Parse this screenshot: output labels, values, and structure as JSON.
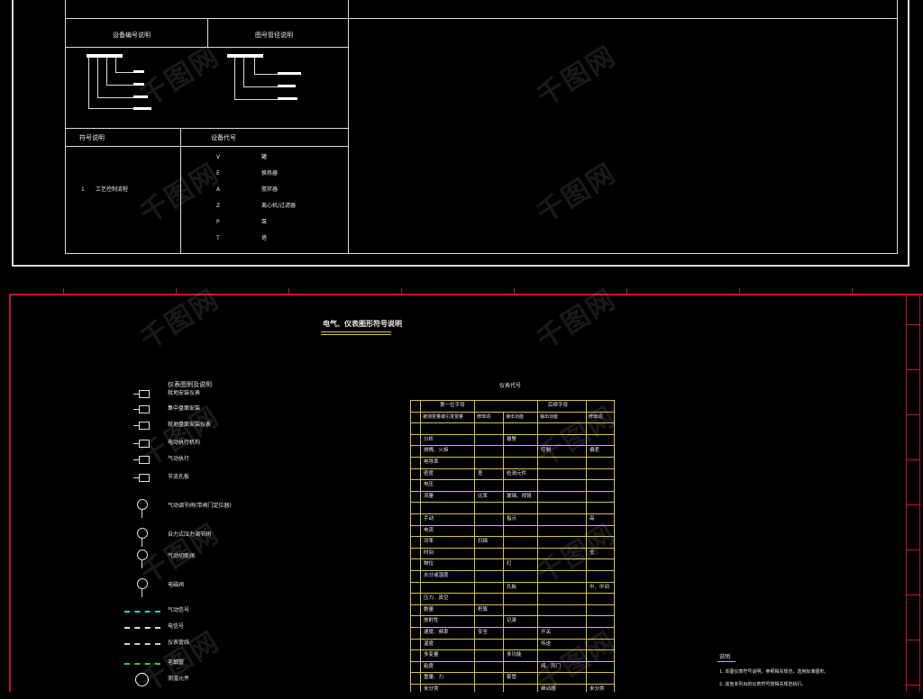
{
  "upper": {
    "legend_number_header": "设备编号说明",
    "legend_pipe_header": "图号管径说明",
    "process_header": "符号说明",
    "device_header": "设备代号",
    "process_item_no": "1",
    "process_item_text": "工艺控制流程",
    "device_codes": [
      {
        "code": "V",
        "name": "罐"
      },
      {
        "code": "E",
        "name": "换热器"
      },
      {
        "code": "A",
        "name": "搅拌器"
      },
      {
        "code": "Z",
        "name": "离心机/过滤器"
      },
      {
        "code": "P",
        "name": "泵"
      },
      {
        "code": "T",
        "name": "塔"
      }
    ]
  },
  "lower": {
    "title": "电气、仪表图形符号说明",
    "legend_title": "仪表图例及说明",
    "symbols": [
      {
        "label": "就地安装仪表"
      },
      {
        "label": "集中盘面安装"
      },
      {
        "label": "就地盘面安装仪表"
      },
      {
        "label": "电动执行机构"
      },
      {
        "label": "气动执行"
      },
      {
        "label": "节流孔板"
      },
      {
        "label": "气动调节阀(带阀门定位器)"
      },
      {
        "label": "自力式压力调节阀"
      },
      {
        "label": "气动切断阀"
      },
      {
        "label": "电磁阀"
      },
      {
        "label": "气动信号"
      },
      {
        "label": "电信号"
      },
      {
        "label": "仪表管线"
      },
      {
        "label": "毛细管"
      },
      {
        "label": "测温元件"
      }
    ],
    "table_caption": "仪表代号",
    "table_headers": [
      "第一位字母",
      "后续字母"
    ],
    "table_subheaders": [
      "被测变量或引发变量",
      "修饰词",
      "读出功能",
      "输出功能",
      "修饰词"
    ],
    "table_rows": [
      [
        "",
        "",
        "",
        "",
        ""
      ],
      [
        "分析",
        "",
        "报警",
        "",
        ""
      ],
      [
        "烧嘴、火焰",
        "",
        "",
        "控制",
        "偏差"
      ],
      [
        "电导率",
        "",
        "",
        "",
        ""
      ],
      [
        "密度",
        "差",
        "检测元件",
        "",
        ""
      ],
      [
        "电压",
        "",
        "",
        "",
        ""
      ],
      [
        "流量",
        "比率",
        "玻璃、视镜",
        "",
        ""
      ],
      [
        "",
        "",
        "",
        "",
        ""
      ],
      [
        "手动",
        "",
        "指示",
        "",
        "高"
      ],
      [
        "电流",
        "",
        "",
        "",
        ""
      ],
      [
        "功率",
        "扫描",
        "",
        "",
        ""
      ],
      [
        "时间",
        "",
        "",
        "",
        "低"
      ],
      [
        "物位",
        "",
        "灯",
        "",
        ""
      ],
      [
        "水分或湿度",
        "",
        "",
        "",
        ""
      ],
      [
        "",
        "",
        "孔板",
        "",
        "中、中间"
      ],
      [
        "压力、真空",
        "",
        "",
        "",
        ""
      ],
      [
        "数量",
        "积算",
        "",
        "",
        ""
      ],
      [
        "放射性",
        "",
        "记录",
        "",
        ""
      ],
      [
        "速度、频率",
        "安全",
        "",
        "开关",
        ""
      ],
      [
        "温度",
        "",
        "",
        "传送",
        ""
      ],
      [
        "多变量",
        "",
        "多功能",
        "",
        ""
      ],
      [
        "粘度",
        "",
        "",
        "阀、风门",
        ""
      ],
      [
        "重量、力",
        "",
        "套管",
        "",
        ""
      ],
      [
        "未分类",
        "",
        "",
        "继动器",
        "未分类"
      ],
      [
        "事件、状态",
        "",
        "",
        "",
        ""
      ],
      [
        "位置、尺寸",
        "",
        "",
        "驱动器",
        ""
      ]
    ],
    "notes_title": "说明",
    "notes": [
      "1. 本图仪表符号说明，参照相关规范，选用标准图形。",
      "2. 其他未列出的仪表符号按相关规范执行。"
    ]
  },
  "watermark": "千图网"
}
